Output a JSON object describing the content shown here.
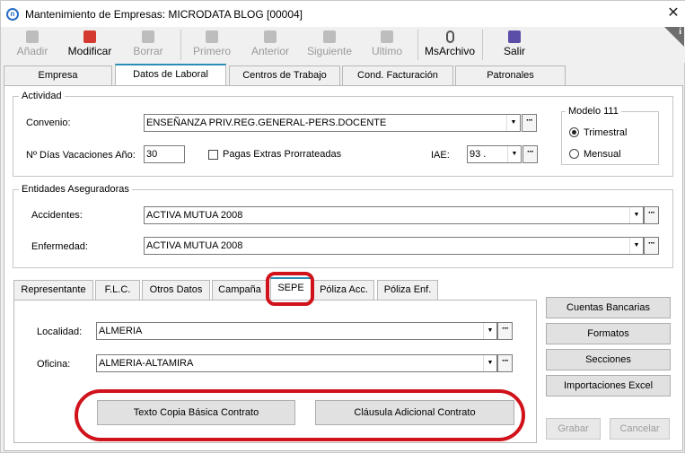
{
  "window": {
    "app_icon": "n",
    "title": "Mantenimiento de Empresas: MICRODATA BLOG [00004]",
    "close_glyph": "✕"
  },
  "toolbar": {
    "add_label": "Añadir",
    "modify_label": "Modificar",
    "delete_label": "Borrar",
    "first_label": "Primero",
    "prev_label": "Anterior",
    "next_label": "Siguiente",
    "last_label": "Ultimo",
    "msarchivo_label": "MsArchivo",
    "exit_label": "Salir",
    "info_glyph": "i"
  },
  "main_tabs": [
    {
      "label": "Empresa"
    },
    {
      "label": "Datos de Laboral"
    },
    {
      "label": "Centros de Trabajo"
    },
    {
      "label": "Cond. Facturación"
    },
    {
      "label": "Patronales"
    }
  ],
  "actividad": {
    "title": "Actividad",
    "convenio_label": "Convenio:",
    "convenio_value": "ENSEÑANZA PRIV.REG.GENERAL-PERS.DOCENTE",
    "vacaciones_label": "Nº Días Vacaciones Año:",
    "vacaciones_value": "30",
    "pagas_label": "Pagas Extras Prorrateadas",
    "iae_label": "IAE:",
    "iae_value": "93 ."
  },
  "modelo111": {
    "title": "Modelo 111",
    "trimestral_label": "Trimestral",
    "mensual_label": "Mensual"
  },
  "entidades": {
    "title": "Entidades Aseguradoras",
    "accidentes_label": "Accidentes:",
    "accidentes_value": "ACTIVA MUTUA 2008",
    "enfermedad_label": "Enfermedad:",
    "enfermedad_value": "ACTIVA MUTUA 2008"
  },
  "sub_tabs": [
    {
      "label": "Representante"
    },
    {
      "label": "F.L.C."
    },
    {
      "label": "Otros Datos"
    },
    {
      "label": "Campaña"
    },
    {
      "label": "SEPE"
    },
    {
      "label": "Póliza Acc."
    },
    {
      "label": "Póliza Enf."
    }
  ],
  "sepe": {
    "localidad_label": "Localidad:",
    "localidad_value": "ALMERIA",
    "oficina_label": "Oficina:",
    "oficina_value": "ALMERIA-ALTAMIRA",
    "texto_copia_label": "Texto Copia Básica Contrato",
    "clausula_label": "Cláusula Adicional Contrato"
  },
  "side_buttons": {
    "cuentas_label": "Cuentas Bancarias",
    "formatos_label": "Formatos",
    "secciones_label": "Secciones",
    "importaciones_label": "Importaciones Excel",
    "grabar_label": "Grabar",
    "cancelar_label": "Cancelar"
  },
  "controls": {
    "dropdown_glyph": "▼",
    "dots_glyph": "···"
  },
  "colors": {
    "highlight_red": "#d0121b",
    "active_tab_accent": "#2b8fb3"
  }
}
